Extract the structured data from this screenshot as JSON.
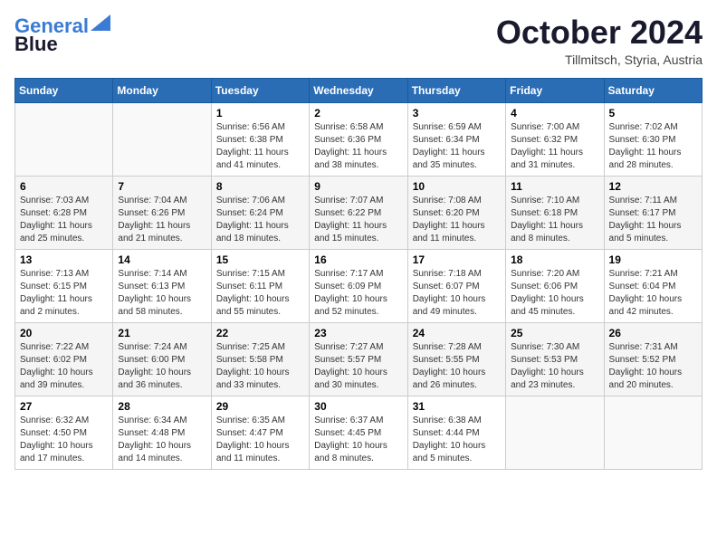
{
  "header": {
    "logo_line1": "General",
    "logo_line2": "Blue",
    "month": "October 2024",
    "location": "Tillmitsch, Styria, Austria"
  },
  "weekdays": [
    "Sunday",
    "Monday",
    "Tuesday",
    "Wednesday",
    "Thursday",
    "Friday",
    "Saturday"
  ],
  "weeks": [
    [
      {
        "day": "",
        "info": ""
      },
      {
        "day": "",
        "info": ""
      },
      {
        "day": "1",
        "info": "Sunrise: 6:56 AM\nSunset: 6:38 PM\nDaylight: 11 hours and 41 minutes."
      },
      {
        "day": "2",
        "info": "Sunrise: 6:58 AM\nSunset: 6:36 PM\nDaylight: 11 hours and 38 minutes."
      },
      {
        "day": "3",
        "info": "Sunrise: 6:59 AM\nSunset: 6:34 PM\nDaylight: 11 hours and 35 minutes."
      },
      {
        "day": "4",
        "info": "Sunrise: 7:00 AM\nSunset: 6:32 PM\nDaylight: 11 hours and 31 minutes."
      },
      {
        "day": "5",
        "info": "Sunrise: 7:02 AM\nSunset: 6:30 PM\nDaylight: 11 hours and 28 minutes."
      }
    ],
    [
      {
        "day": "6",
        "info": "Sunrise: 7:03 AM\nSunset: 6:28 PM\nDaylight: 11 hours and 25 minutes."
      },
      {
        "day": "7",
        "info": "Sunrise: 7:04 AM\nSunset: 6:26 PM\nDaylight: 11 hours and 21 minutes."
      },
      {
        "day": "8",
        "info": "Sunrise: 7:06 AM\nSunset: 6:24 PM\nDaylight: 11 hours and 18 minutes."
      },
      {
        "day": "9",
        "info": "Sunrise: 7:07 AM\nSunset: 6:22 PM\nDaylight: 11 hours and 15 minutes."
      },
      {
        "day": "10",
        "info": "Sunrise: 7:08 AM\nSunset: 6:20 PM\nDaylight: 11 hours and 11 minutes."
      },
      {
        "day": "11",
        "info": "Sunrise: 7:10 AM\nSunset: 6:18 PM\nDaylight: 11 hours and 8 minutes."
      },
      {
        "day": "12",
        "info": "Sunrise: 7:11 AM\nSunset: 6:17 PM\nDaylight: 11 hours and 5 minutes."
      }
    ],
    [
      {
        "day": "13",
        "info": "Sunrise: 7:13 AM\nSunset: 6:15 PM\nDaylight: 11 hours and 2 minutes."
      },
      {
        "day": "14",
        "info": "Sunrise: 7:14 AM\nSunset: 6:13 PM\nDaylight: 10 hours and 58 minutes."
      },
      {
        "day": "15",
        "info": "Sunrise: 7:15 AM\nSunset: 6:11 PM\nDaylight: 10 hours and 55 minutes."
      },
      {
        "day": "16",
        "info": "Sunrise: 7:17 AM\nSunset: 6:09 PM\nDaylight: 10 hours and 52 minutes."
      },
      {
        "day": "17",
        "info": "Sunrise: 7:18 AM\nSunset: 6:07 PM\nDaylight: 10 hours and 49 minutes."
      },
      {
        "day": "18",
        "info": "Sunrise: 7:20 AM\nSunset: 6:06 PM\nDaylight: 10 hours and 45 minutes."
      },
      {
        "day": "19",
        "info": "Sunrise: 7:21 AM\nSunset: 6:04 PM\nDaylight: 10 hours and 42 minutes."
      }
    ],
    [
      {
        "day": "20",
        "info": "Sunrise: 7:22 AM\nSunset: 6:02 PM\nDaylight: 10 hours and 39 minutes."
      },
      {
        "day": "21",
        "info": "Sunrise: 7:24 AM\nSunset: 6:00 PM\nDaylight: 10 hours and 36 minutes."
      },
      {
        "day": "22",
        "info": "Sunrise: 7:25 AM\nSunset: 5:58 PM\nDaylight: 10 hours and 33 minutes."
      },
      {
        "day": "23",
        "info": "Sunrise: 7:27 AM\nSunset: 5:57 PM\nDaylight: 10 hours and 30 minutes."
      },
      {
        "day": "24",
        "info": "Sunrise: 7:28 AM\nSunset: 5:55 PM\nDaylight: 10 hours and 26 minutes."
      },
      {
        "day": "25",
        "info": "Sunrise: 7:30 AM\nSunset: 5:53 PM\nDaylight: 10 hours and 23 minutes."
      },
      {
        "day": "26",
        "info": "Sunrise: 7:31 AM\nSunset: 5:52 PM\nDaylight: 10 hours and 20 minutes."
      }
    ],
    [
      {
        "day": "27",
        "info": "Sunrise: 6:32 AM\nSunset: 4:50 PM\nDaylight: 10 hours and 17 minutes."
      },
      {
        "day": "28",
        "info": "Sunrise: 6:34 AM\nSunset: 4:48 PM\nDaylight: 10 hours and 14 minutes."
      },
      {
        "day": "29",
        "info": "Sunrise: 6:35 AM\nSunset: 4:47 PM\nDaylight: 10 hours and 11 minutes."
      },
      {
        "day": "30",
        "info": "Sunrise: 6:37 AM\nSunset: 4:45 PM\nDaylight: 10 hours and 8 minutes."
      },
      {
        "day": "31",
        "info": "Sunrise: 6:38 AM\nSunset: 4:44 PM\nDaylight: 10 hours and 5 minutes."
      },
      {
        "day": "",
        "info": ""
      },
      {
        "day": "",
        "info": ""
      }
    ]
  ]
}
